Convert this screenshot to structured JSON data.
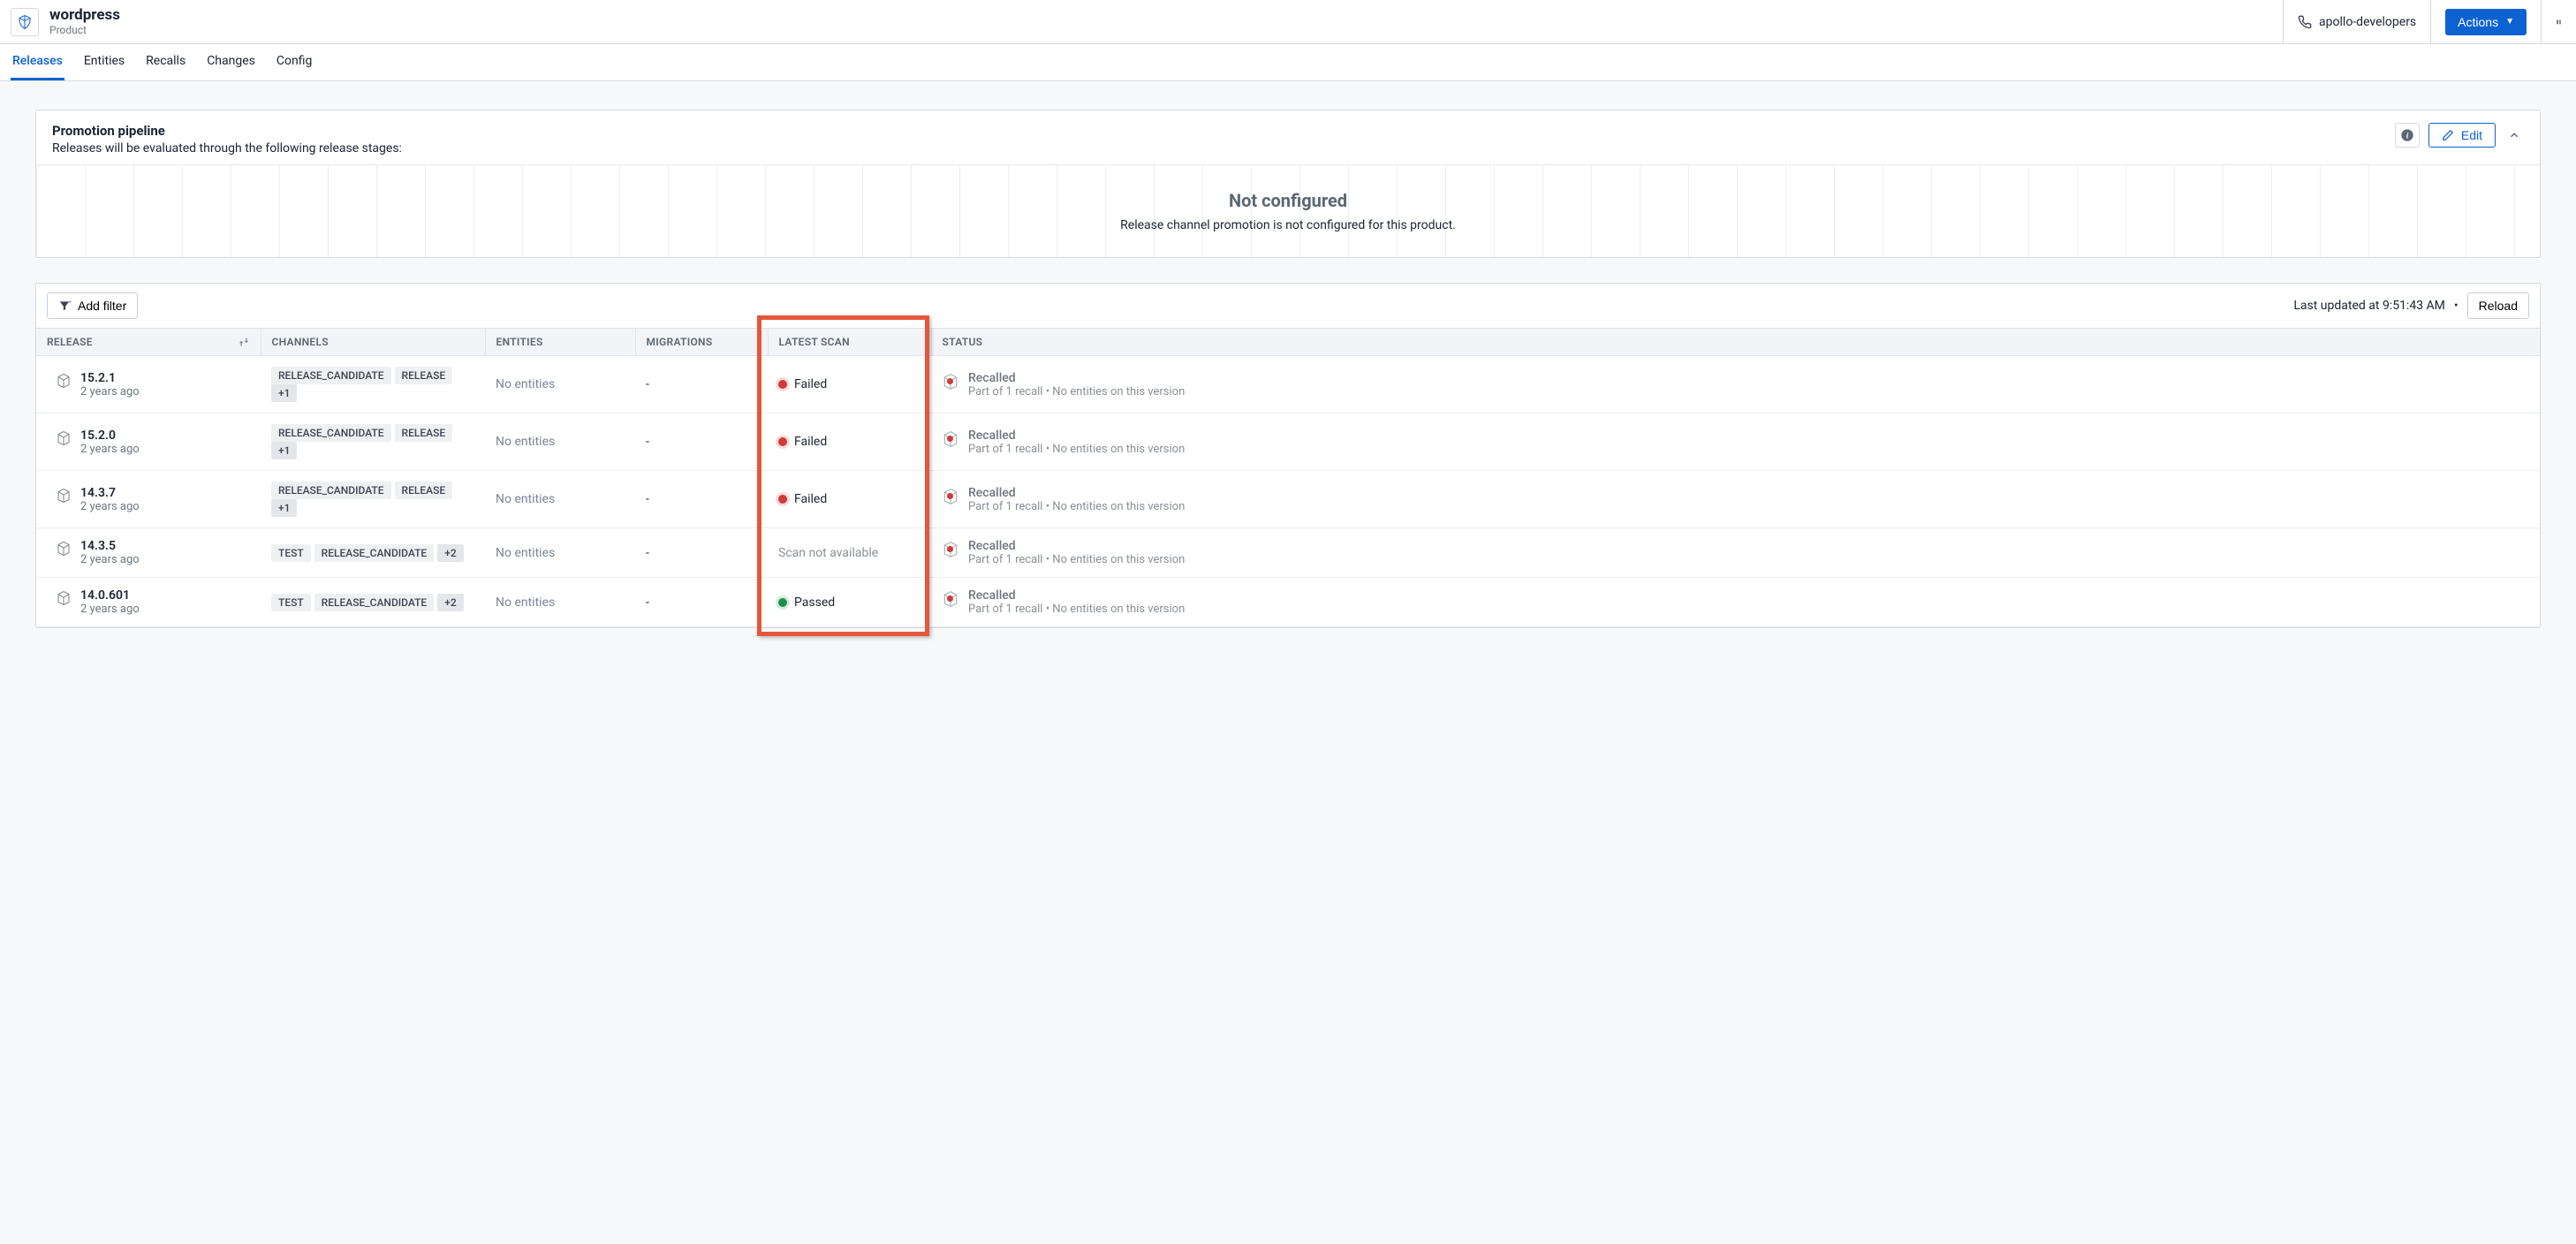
{
  "header": {
    "product_name": "wordpress",
    "product_type": "Product",
    "org": "apollo-developers",
    "actions_label": "Actions"
  },
  "tabs": [
    {
      "label": "Releases",
      "active": true
    },
    {
      "label": "Entities",
      "active": false
    },
    {
      "label": "Recalls",
      "active": false
    },
    {
      "label": "Changes",
      "active": false
    },
    {
      "label": "Config",
      "active": false
    }
  ],
  "pipeline": {
    "title": "Promotion pipeline",
    "description": "Releases will be evaluated through the following release stages:",
    "edit_label": "Edit",
    "empty_title": "Not configured",
    "empty_desc": "Release channel promotion is not configured for this product."
  },
  "toolbar": {
    "add_filter_label": "Add filter",
    "last_updated": "Last updated at 9:51:43 AM",
    "reload_label": "Reload"
  },
  "columns": {
    "release": "RELEASE",
    "channels": "CHANNELS",
    "entities": "ENTITIES",
    "migrations": "MIGRATIONS",
    "latest_scan": "LATEST SCAN",
    "status": "STATUS"
  },
  "rows": [
    {
      "version": "15.2.1",
      "age": "2 years ago",
      "channels": [
        "RELEASE_CANDIDATE",
        "RELEASE"
      ],
      "channels_more": "+1",
      "entities": "No entities",
      "migrations": "-",
      "scan": {
        "state": "failed",
        "label": "Failed"
      },
      "status": {
        "title": "Recalled",
        "sub": "Part of 1 recall • No entities on this version"
      }
    },
    {
      "version": "15.2.0",
      "age": "2 years ago",
      "channels": [
        "RELEASE_CANDIDATE",
        "RELEASE"
      ],
      "channels_more": "+1",
      "entities": "No entities",
      "migrations": "-",
      "scan": {
        "state": "failed",
        "label": "Failed"
      },
      "status": {
        "title": "Recalled",
        "sub": "Part of 1 recall • No entities on this version"
      }
    },
    {
      "version": "14.3.7",
      "age": "2 years ago",
      "channels": [
        "RELEASE_CANDIDATE",
        "RELEASE"
      ],
      "channels_more": "+1",
      "entities": "No entities",
      "migrations": "-",
      "scan": {
        "state": "failed",
        "label": "Failed"
      },
      "status": {
        "title": "Recalled",
        "sub": "Part of 1 recall • No entities on this version"
      }
    },
    {
      "version": "14.3.5",
      "age": "2 years ago",
      "channels": [
        "TEST",
        "RELEASE_CANDIDATE"
      ],
      "channels_more": "+2",
      "entities": "No entities",
      "migrations": "-",
      "scan": {
        "state": "na",
        "label": "Scan not available"
      },
      "status": {
        "title": "Recalled",
        "sub": "Part of 1 recall • No entities on this version"
      }
    },
    {
      "version": "14.0.601",
      "age": "2 years ago",
      "channels": [
        "TEST",
        "RELEASE_CANDIDATE"
      ],
      "channels_more": "+2",
      "entities": "No entities",
      "migrations": "-",
      "scan": {
        "state": "passed",
        "label": "Passed"
      },
      "status": {
        "title": "Recalled",
        "sub": "Part of 1 recall • No entities on this version"
      }
    }
  ]
}
